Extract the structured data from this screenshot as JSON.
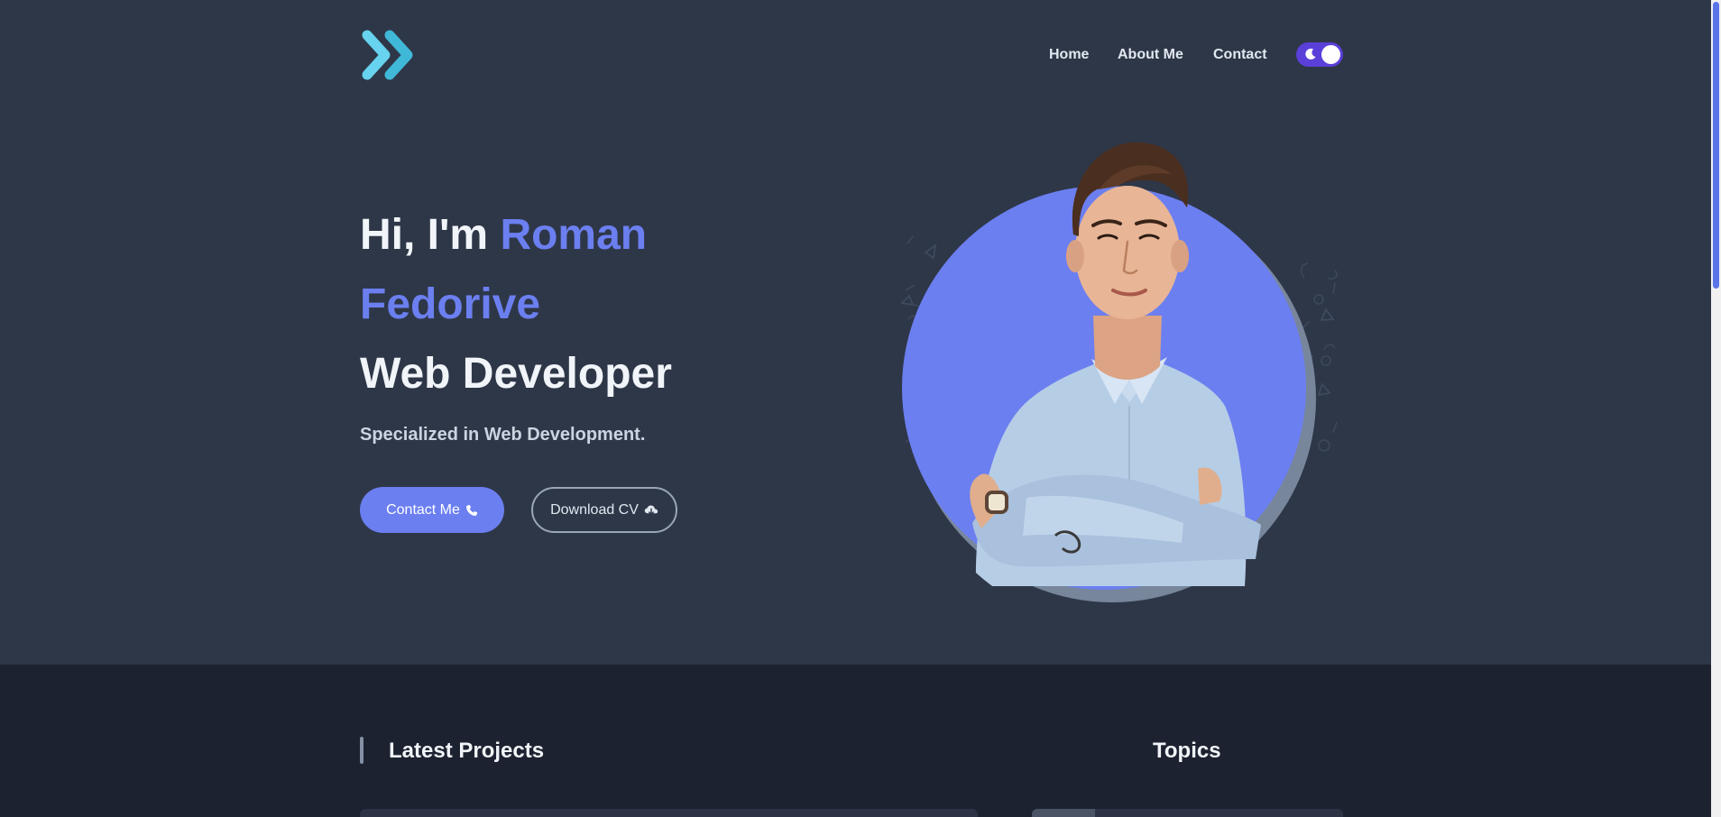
{
  "header": {
    "logo": "double-chevron-logo",
    "nav": [
      "Home",
      "About Me",
      "Contact"
    ],
    "theme_toggle": "moon-icon"
  },
  "hero": {
    "greeting": "Hi, I'm ",
    "name": "Roman Fedorive",
    "role": "Web Developer",
    "tagline": "Specialized in Web Development.",
    "contact_button": "Contact Me",
    "download_button": "Download CV"
  },
  "sections": {
    "latest_projects": "Latest Projects",
    "topics": "Topics"
  },
  "colors": {
    "accent": "#6b7ff0",
    "hero_bg": "#2e3748",
    "lower_bg": "#1c2230",
    "toggle": "#5b3fd9",
    "logo_light": "#67d3ee",
    "logo_dark": "#40b8d8"
  }
}
